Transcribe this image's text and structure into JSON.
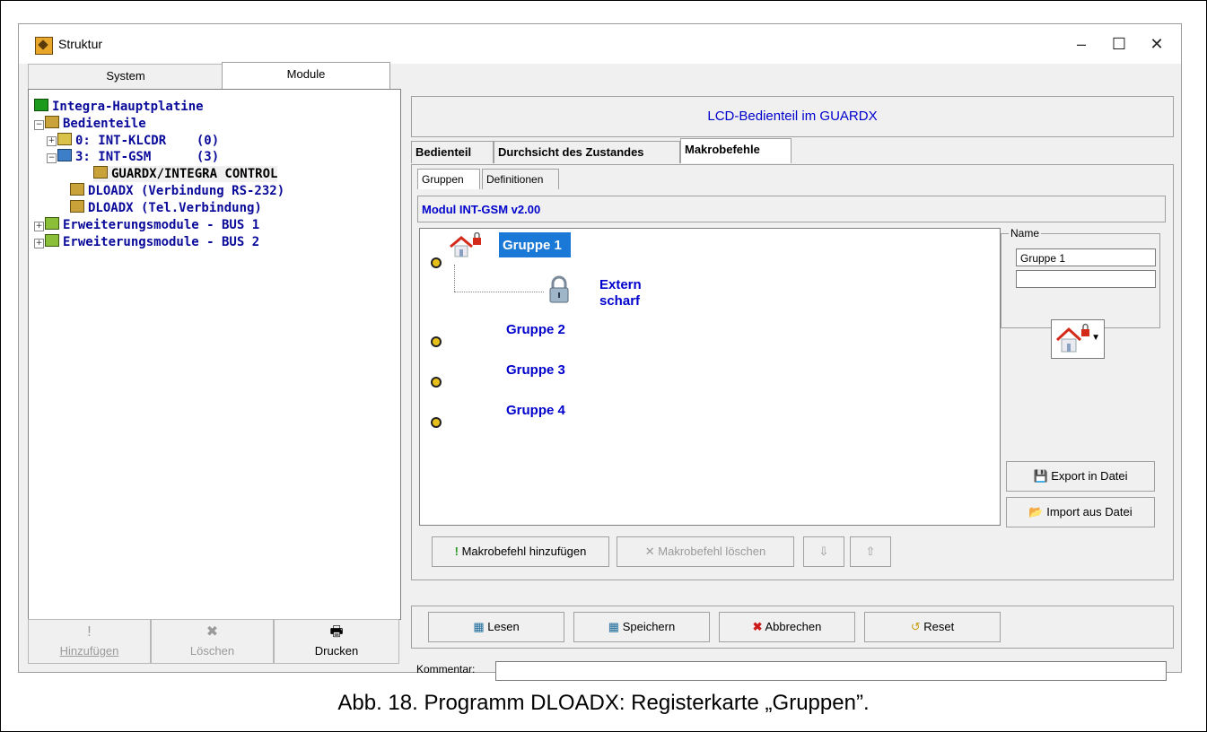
{
  "window": {
    "title": "Struktur",
    "minimize": "–",
    "maximize": "☐",
    "close": "✕"
  },
  "top_tabs": [
    {
      "label": "System"
    },
    {
      "label": "Module"
    }
  ],
  "tree": {
    "root": "Integra-Hauptplatine",
    "bedienteile": "Bedienteile",
    "klcdr": "0: INT-KLCDR    (0)",
    "gsm": "3: INT-GSM      (3)",
    "guardx": "GUARDX/INTEGRA CONTROL",
    "dloadx_rs": "DLOADX (Verbindung RS-232)",
    "dloadx_tel": "DLOADX (Tel.Verbindung)",
    "bus1": "Erweiterungsmodule - BUS 1",
    "bus2": "Erweiterungsmodule - BUS 2"
  },
  "left_buttons": {
    "add": "Hinzufügen",
    "delete": "Löschen",
    "print": "Drucken"
  },
  "header": "LCD-Bedienteil im GUARDX",
  "tabs": [
    {
      "label": "Bedienteil"
    },
    {
      "label": "Durchsicht des Zustandes"
    },
    {
      "label": "Makrobefehle"
    }
  ],
  "subtabs": [
    {
      "label": "Gruppen"
    },
    {
      "label": "Definitionen"
    }
  ],
  "module_label": "Modul INT-GSM v2.00",
  "groups": [
    {
      "label": "Gruppe 1"
    },
    {
      "label": "Gruppe 2"
    },
    {
      "label": "Gruppe 3"
    },
    {
      "label": "Gruppe 4"
    }
  ],
  "macro": {
    "label_line1": "Extern",
    "label_line2": "scharf"
  },
  "name_box": {
    "legend": "Name",
    "value": "Gruppe 1",
    "value2": ""
  },
  "side_buttons": {
    "export": "Export in Datei",
    "import": "Import aus Datei"
  },
  "list_buttons": {
    "add_macro": "Makrobefehl hinzufügen",
    "delete_macro": "Makrobefehl löschen",
    "down": "⇩",
    "up": "⇧"
  },
  "bottom_buttons": {
    "read": "Lesen",
    "save": "Speichern",
    "cancel": "Abbrechen",
    "reset": "Reset"
  },
  "comment": {
    "label": "Kommentar:",
    "value": ""
  },
  "caption": "Abb. 18. Programm DLOADX: Registerkarte „Gruppen”."
}
